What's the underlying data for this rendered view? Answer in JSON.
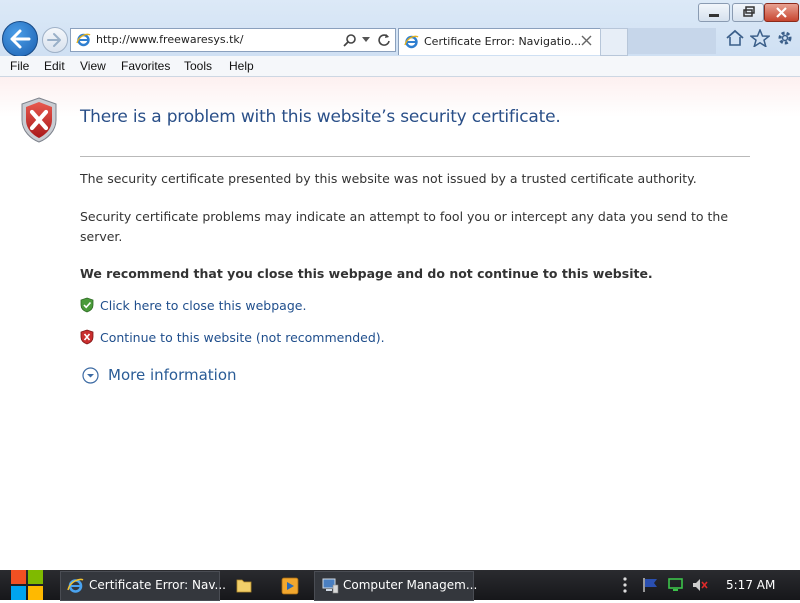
{
  "browser": {
    "url": "http://www.freewaresys.tk/",
    "tab_title": "Certificate Error: Navigatio...",
    "menu": [
      "File",
      "Edit",
      "View",
      "Favorites",
      "Tools",
      "Help"
    ]
  },
  "page": {
    "heading": "There is a problem with this website’s security certificate.",
    "paragraphs": [
      "The security certificate presented by this website was not issued by a trusted certificate authority.",
      "Security certificate problems may indicate an attempt to fool you or intercept any data you send to the server."
    ],
    "recommendation": "We recommend that you close this webpage and do not continue to this website.",
    "close_link": "Click here to close this webpage.",
    "continue_link": "Continue to this website (not recommended).",
    "more_info": "More information"
  },
  "taskbar": {
    "items": [
      {
        "label": "Certificate Error: Nav...",
        "icon": "ie-icon"
      },
      {
        "label": "",
        "icon": "folder-icon"
      },
      {
        "label": "",
        "icon": "media-player-icon"
      },
      {
        "label": "Computer Managem...",
        "icon": "computer-management-icon"
      }
    ],
    "clock": "5:17 AM"
  },
  "colors": {
    "heading": "#2a4f88",
    "link": "#1f4e8c",
    "shield_red": "#c62a2a",
    "shield_green": "#3a8a2a"
  }
}
